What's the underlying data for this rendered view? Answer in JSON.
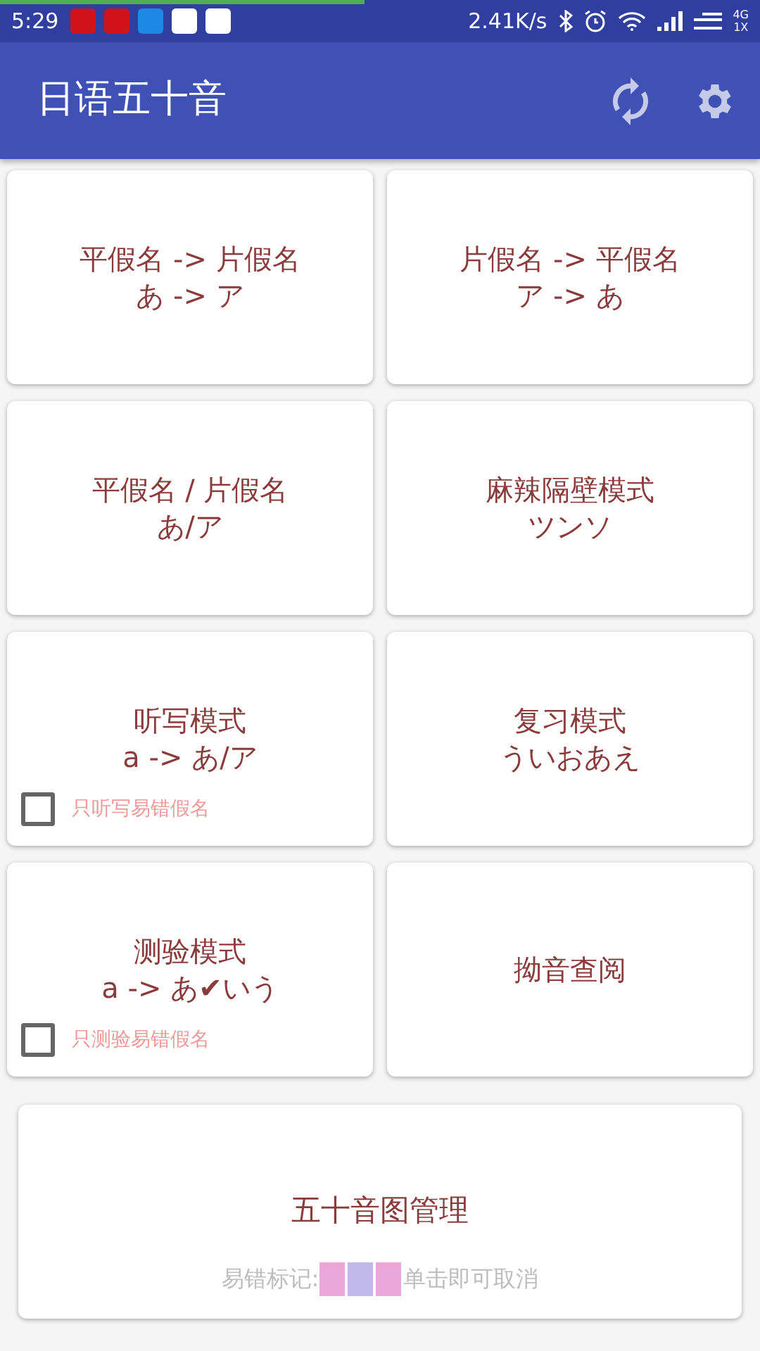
{
  "status_bar": {
    "progress": {
      "level": 0.48
    },
    "time": "5:29",
    "app_icons": [
      {
        "color": "#d0121b"
      },
      {
        "color": "#d0121b"
      },
      {
        "color": "#1e88e5"
      },
      {
        "color": "#ffffff"
      },
      {
        "color": "#ffffff"
      }
    ],
    "speed": "2.41K/s",
    "network": "4G",
    "network_sub": "1X"
  },
  "app_bar": {
    "title": "日语五十音"
  },
  "cards": [
    {
      "lines": [
        "平假名 -> 片假名",
        "あ -> ア"
      ]
    },
    {
      "lines": [
        "片假名 -> 平假名",
        "ア -> あ"
      ]
    },
    {
      "lines": [
        "平假名 / 片假名",
        "あ/ア"
      ]
    },
    {
      "lines": [
        "麻辣隔壁模式",
        "ツンソ"
      ]
    },
    {
      "lines": [
        "听写模式",
        "a -> あ/ア"
      ],
      "option": {
        "label": "只听写易错假名",
        "checked": false
      }
    },
    {
      "lines": [
        "复习模式",
        "ういおあえ"
      ]
    },
    {
      "lines": [
        "测验模式",
        "a -> あ✔いう"
      ],
      "option": {
        "label": "只测验易错假名",
        "checked": false
      }
    },
    {
      "lines": [
        "拗音查阅"
      ]
    }
  ],
  "manage_card": {
    "title": "五十音图管理",
    "legend_label": "易错标记:",
    "swatches": [
      {
        "color": "#e8a8d8"
      },
      {
        "color": "#c0b8e8"
      },
      {
        "color": "#e8a8d8"
      }
    ],
    "hint": "单击即可取消"
  }
}
